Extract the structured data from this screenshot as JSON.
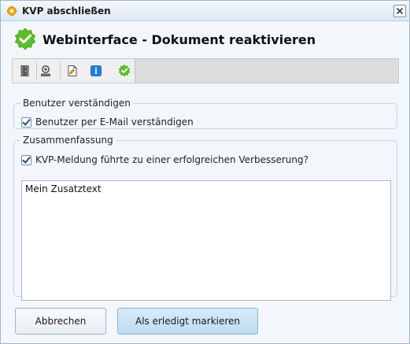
{
  "window": {
    "title": "KVP abschließen",
    "close_icon": "close-icon"
  },
  "header": {
    "title": "Webinterface - Dokument reaktivieren",
    "icon": "green-check-badge-icon"
  },
  "toolbar": {
    "items": [
      {
        "name": "exit-door-icon"
      },
      {
        "name": "stamp-icon"
      },
      {
        "name": "document-edit-icon"
      },
      {
        "name": "info-icon"
      },
      {
        "name": "check-badge-icon"
      }
    ]
  },
  "notify_group": {
    "legend": "Benutzer verständigen",
    "checkbox_label": "Benutzer per E-Mail verständigen",
    "checked": true
  },
  "summary_group": {
    "legend": "Zusammenfassung",
    "checkbox_label": "KVP-Meldung führte zu einer erfolgreichen Verbesserung?",
    "checked": true,
    "text_value": "Mein Zusatztext"
  },
  "buttons": {
    "cancel": "Abbrechen",
    "confirm": "Als erledigt markieren"
  },
  "colors": {
    "accent_green": "#5cbf2a",
    "info_blue": "#1e7fd8",
    "primary_button": "#c8e2f4"
  }
}
